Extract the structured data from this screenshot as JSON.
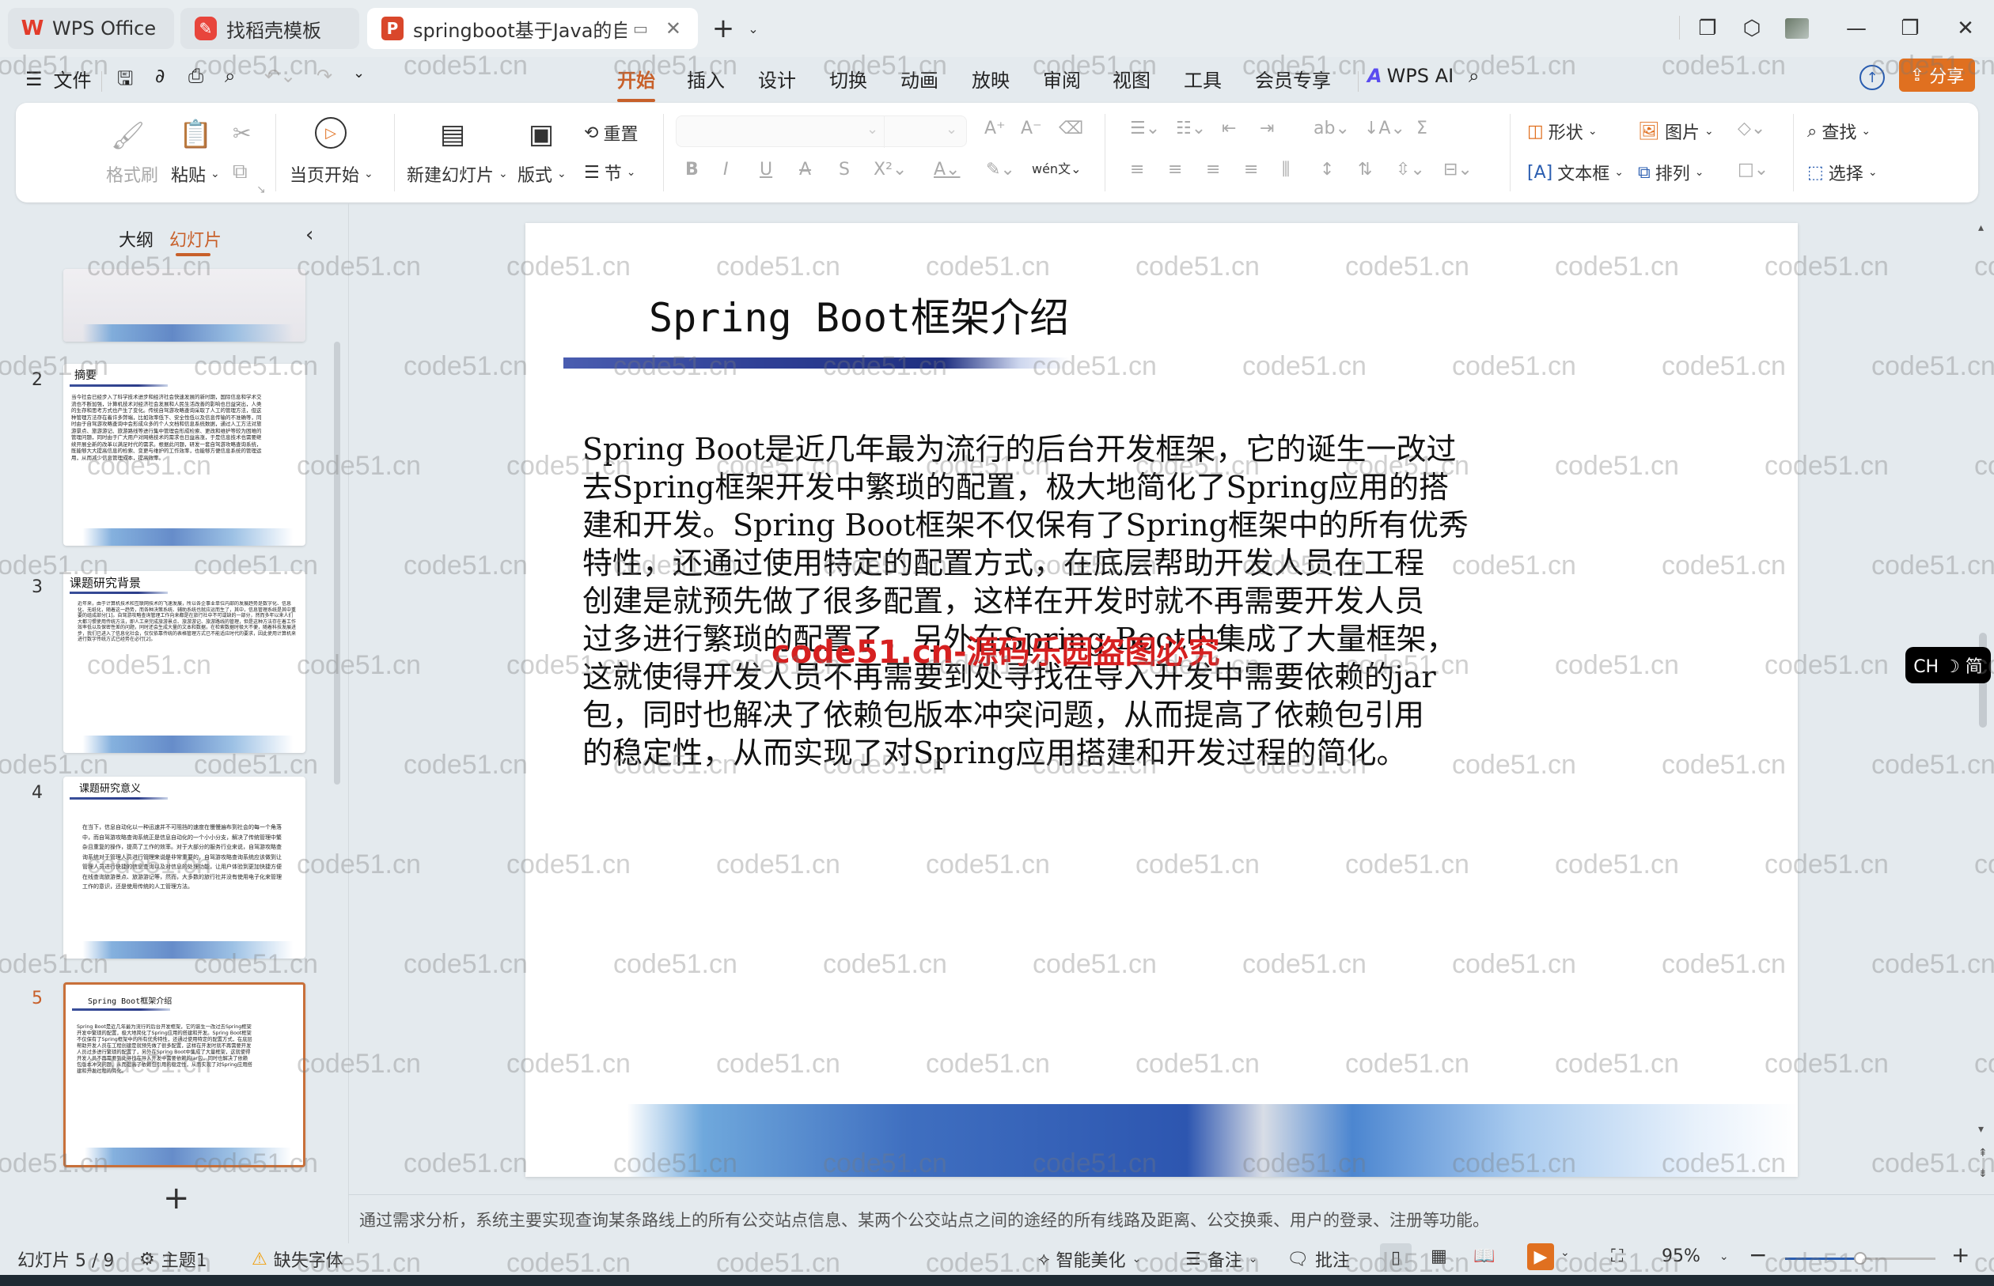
{
  "titlebar": {
    "tabs": [
      {
        "label": "WPS Office",
        "icon": "wps-logo-icon"
      },
      {
        "label": "找稻壳模板",
        "icon": "docer-icon"
      },
      {
        "label": "springboot基于Java的自驾游",
        "icon": "presentation-file-icon",
        "active": true
      }
    ],
    "new_tab": "+",
    "window_buttons": [
      "layout-icon",
      "3d-box-icon",
      "avatar",
      "minimize-icon",
      "restore-icon",
      "close-icon"
    ]
  },
  "menubar": {
    "file_label": "文件",
    "tabs": [
      "开始",
      "插入",
      "设计",
      "切换",
      "动画",
      "放映",
      "审阅",
      "视图",
      "工具",
      "会员专享"
    ],
    "active_tab": "开始",
    "ai_label": "WPS AI",
    "share_label": "分享"
  },
  "ribbon": {
    "format_painter": "格式刷",
    "paste": "粘贴",
    "start_from_current": "当页开始",
    "new_slide": "新建幻灯片",
    "layout": "版式",
    "reset": "重置",
    "section": "节",
    "shape": "形状",
    "picture": "图片",
    "textbox": "文本框",
    "arrange": "排列",
    "find": "查找",
    "select": "选择",
    "font_name": "",
    "font_size": ""
  },
  "left_panel": {
    "tabs": [
      "大纲",
      "幻灯片"
    ],
    "active_tab": "幻灯片",
    "add_slide": "+",
    "slides": [
      {
        "num": "",
        "title": "",
        "body": ""
      },
      {
        "num": "2",
        "title": "摘要",
        "body": "当今社会已经步入了科学技术进步和经济社会快速发展的新时期，国际信息和学术交流也不断加强，计算机技术对经济社会发展和人民生活改善的影响也日益突出，人类的生存和思考方式也产生了变化。传统自驾游攻略查询采取了人工的管理方法，但这种管理方法存在着许多弊端，比如效率低下、安全性低以及信息传输的不准确等，同时由于自驾游攻略查询中会形成众多的个人文档和信息系统数据，通过人工方法对旅游景点、旅游游记、旅游路线等进行集中管理会形成检索、更改和维护等较为困难的管理问题，同时由于广大用户对网络技术的需求也日益高涨，于是信息技术也需要继续开展全新的改革以满足时代的需求。根据此问题，研发一套自驾游攻略查询系统，既能够大大提高信息的检索、变更与维护的工作效率，也能够方便信息系统的管理运用，从而减少信息管理成本，提高效率。"
      },
      {
        "num": "3",
        "title": "课题研究背景",
        "body": "近年来，由于计算机技术和互联网技术的飞速发展，所以各企事业单位内部的发展趋势是数字化、信息化、无纸化，随着这一趋势，而各种决策系统、辅助系统也就应运而生了，其中，信息管理系统是其中重要的组成部分[1]。自驾游攻略查询管理工作向来都是在旅行社中不可或缺的一部分，然而多年以来人们大都习惯使用传统方法，即人工来完成旅游景点、旅游游记、旅游路线的管理，但是这种方法存在着工作效率低以及保密性差的问题，同时还会生成大量的文本和数据，在检索数据时极大不便，随着科技发展进步，我们已进入了信息化社会，仅仅依靠传统的表格管理方式已不能适应时代的要求，因此使用计算机来进行数字传统方式已经势在必行[2]。"
      },
      {
        "num": "4",
        "title": "课题研究意义",
        "body": "在当下，信息自动化以一种迅速并不可阻挡的速度在慢慢遍布到社会的每一个角落中，而自驾游攻略查询系统正是信息自动化的一个小小分支，解决了传统管理中繁杂且重复的操作，提高了工作的效率。对于大部分的服务行业来说，自驾游攻略查询系统对于管理人员进行管理来说是非常重要的，自驾游攻略查询系统应该做到让管理人员进行快捷的信息查询以及对信息的处理功能，让用户体验到更加快捷方便在线查询旅游景点、旅游游记等，然而，大多数的旅行社并没有使用电子化来管理工作的意识，还是使用传统的人工管理方法。"
      },
      {
        "num": "5",
        "title": "Spring Boot框架介绍",
        "body": "Spring Boot是近几年最为流行的后台开发框架，它的诞生一改过去Spring框架开发中繁琐的配置，极大地简化了Spring应用的搭建和开发。Spring Boot框架不仅保有了Spring框架中的所有优秀特性，还通过使用特定的配置方式，在底层帮助开发人员在工程创建是就预先做了很多配置，这样在开发时就不再需要开发人员过多进行繁琐的配置了，另外在Spring Boot中集成了大量框架，这就使得开发人员不再需要到处寻找在导入开发中需要依赖的jar包，同时也解决了依赖包版本冲突问题，从而提高了依赖包引用的稳定性，从而实现了对Spring应用搭建和开发过程的简化。",
        "selected": true
      }
    ]
  },
  "slide": {
    "title": "Spring Boot框架介绍",
    "body_lines": [
      "Spring Boot是近几年最为流行的后台开发框架，它的诞生一改过",
      "去Spring框架开发中繁琐的配置，极大地简化了Spring应用的搭",
      "建和开发。Spring Boot框架不仅保有了Spring框架中的所有优秀",
      "特性，还通过使用特定的配置方式，在底层帮助开发人员在工程",
      "创建是就预先做了很多配置，这样在开发时就不再需要开发人员",
      "过多进行繁琐的配置了，另外在Spring Boot中集成了大量框架，",
      "这就使得开发人员不再需要到处寻找在导入开发中需要依赖的jar",
      "包，同时也解决了依赖包版本冲突问题，从而提高了依赖包引用",
      "的稳定性，从而实现了对Spring应用搭建和开发过程的简化。"
    ],
    "stamp": "code51.cn-源码乐园盗图必究"
  },
  "notes": {
    "text": "通过需求分析，系统主要实现查询某条路线上的所有公交站点信息、某两个公交站点之间的途经的所有线路及距离、公交换乘、用户的登录、注册等功能。"
  },
  "statusbar": {
    "slide_counter": "幻灯片 5 / 9",
    "theme": "主题1",
    "missing_font": "缺失字体",
    "smart_beautify": "智能美化",
    "notes": "备注",
    "comment": "批注",
    "zoom": "95%",
    "zoom_fraction": 0.5
  },
  "ime": {
    "label": "CH ☽ 简"
  },
  "watermark": "code51.cn",
  "colors": {
    "accent": "#c8602a",
    "share": "#e07020",
    "stamp": "#d62020"
  }
}
